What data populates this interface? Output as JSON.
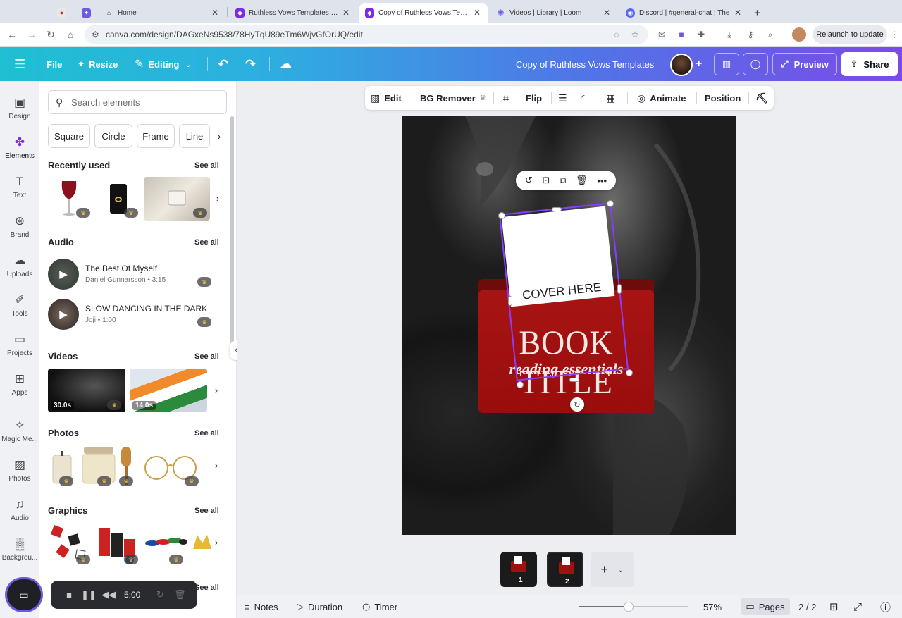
{
  "browser": {
    "tabs": [
      {
        "label": "",
        "active": false
      },
      {
        "label": "",
        "active": false
      },
      {
        "label": "Home",
        "active": false
      },
      {
        "label": "Ruthless Vows Templates - In",
        "active": false
      },
      {
        "label": "Copy of Ruthless Vows Temp",
        "active": true
      },
      {
        "label": "Videos | Library | Loom",
        "active": false
      },
      {
        "label": "Discord | #general-chat | The",
        "active": false
      }
    ],
    "url": "canva.com/design/DAGxeNs9538/78HyTqU89eTm6WjvGfOrUQ/edit",
    "relaunch": "Relaunch to update"
  },
  "header": {
    "file": "File",
    "resize": "Resize",
    "editing": "Editing",
    "title": "Copy of Ruthless Vows Templates",
    "preview": "Preview",
    "share": "Share",
    "accent": "#7b4ae8"
  },
  "rail": [
    {
      "label": "Design",
      "icon": "design-icon"
    },
    {
      "label": "Elements",
      "icon": "elements-icon"
    },
    {
      "label": "Text",
      "icon": "text-icon"
    },
    {
      "label": "Brand",
      "icon": "brand-icon"
    },
    {
      "label": "Uploads",
      "icon": "uploads-icon"
    },
    {
      "label": "Tools",
      "icon": "tools-icon"
    },
    {
      "label": "Projects",
      "icon": "projects-icon"
    },
    {
      "label": "Apps",
      "icon": "apps-icon"
    },
    {
      "label": "Magic Me...",
      "icon": "magic-media-icon"
    },
    {
      "label": "Photos",
      "icon": "photos-icon"
    },
    {
      "label": "Audio",
      "icon": "audio-icon"
    },
    {
      "label": "Backgrou...",
      "icon": "background-icon"
    }
  ],
  "panel": {
    "search_placeholder": "Search elements",
    "chips": [
      "Square",
      "Circle",
      "Frame",
      "Line"
    ],
    "see_all": "See all",
    "recently_used": "Recently used",
    "audio_title": "Audio",
    "audio": [
      {
        "title": "The Best Of Myself",
        "sub": "Daniel Gunnarsson • 3:15"
      },
      {
        "title": "SLOW DANCING IN THE DARK",
        "sub": "Joji • 1:00"
      }
    ],
    "videos_title": "Videos",
    "videos": [
      "30.0s",
      "14.0s"
    ],
    "photos_title": "Photos",
    "graphics_title": "Graphics"
  },
  "recorder": {
    "time": "5:00"
  },
  "context_toolbar": {
    "edit": "Edit",
    "bg_remover": "BG Remover",
    "flip": "Flip",
    "animate": "Animate",
    "position": "Position"
  },
  "design": {
    "cover_text": "COVER HERE",
    "book_title": "BOOK TITLE",
    "subtitle": "reading essentials"
  },
  "pages": [
    "1",
    "2"
  ],
  "footer": {
    "notes": "Notes",
    "duration": "Duration",
    "timer": "Timer",
    "zoom": "57%",
    "zoom_fraction": 0.45,
    "pages": "Pages",
    "page_count": "2 / 2"
  }
}
